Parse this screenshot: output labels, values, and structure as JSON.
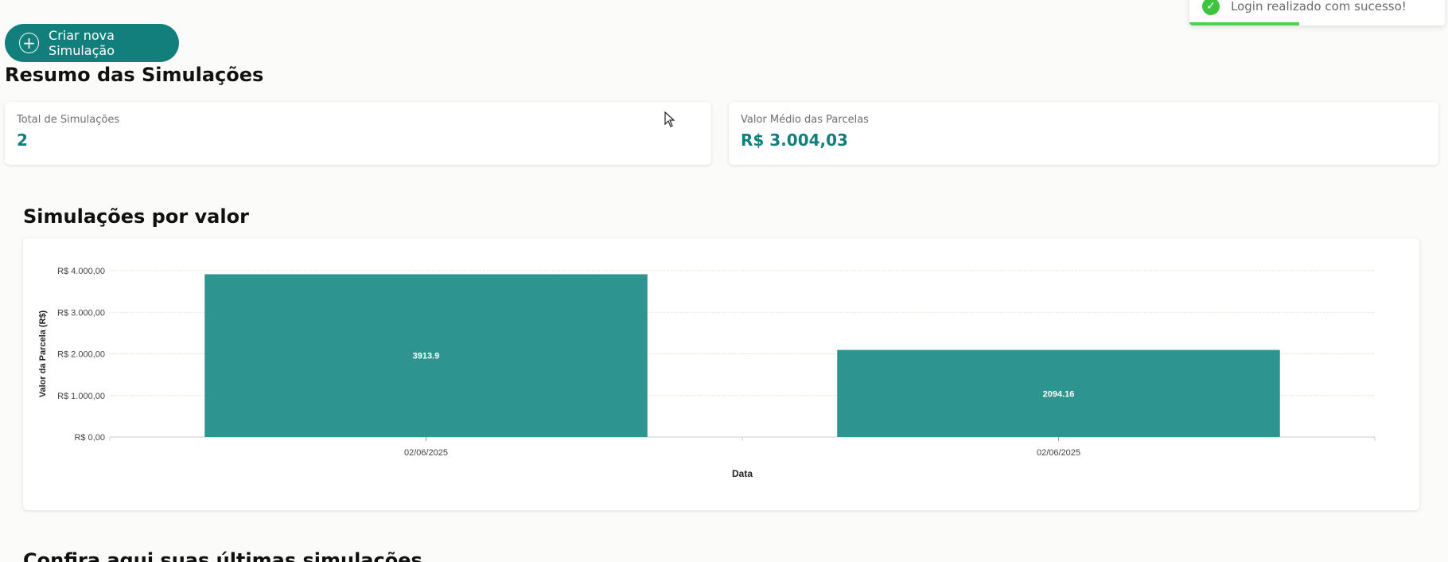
{
  "toolbar": {
    "create_label": "Criar nova Simulação"
  },
  "toast": {
    "message": "Login realizado com sucesso!",
    "progress_fraction": 0.43
  },
  "summary": {
    "title": "Resumo das Simulações",
    "cards": [
      {
        "label": "Total de Simulações",
        "value": "2"
      },
      {
        "label": "Valor Médio das Parcelas",
        "value": "R$ 3.004,03"
      }
    ]
  },
  "chart_section": {
    "title": "Simulações por valor"
  },
  "chart_data": {
    "type": "bar",
    "categories": [
      "02/06/2025",
      "02/06/2025"
    ],
    "values": [
      3913.9,
      2094.16
    ],
    "value_labels": [
      "3913.9",
      "2094.16"
    ],
    "xlabel": "Data",
    "ylabel": "Valor da Parcela (R$)",
    "ylim": [
      0,
      4000
    ],
    "yticks": [
      0,
      1000,
      2000,
      3000,
      4000
    ],
    "ytick_labels": [
      "R$ 0,00",
      "R$ 1.000,00",
      "R$ 2.000,00",
      "R$ 3.000,00",
      "R$ 4.000,00"
    ],
    "grid": true,
    "bar_color": "#2e9490",
    "grid_color": "#e4e8d8"
  },
  "recent": {
    "title": "Confira aqui suas últimas simulações"
  }
}
